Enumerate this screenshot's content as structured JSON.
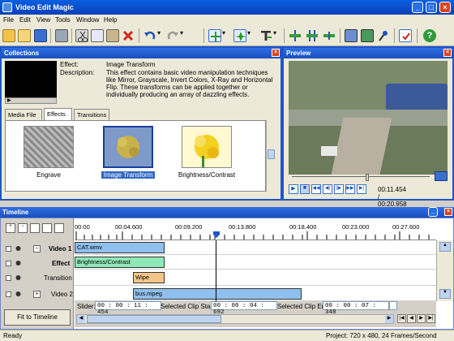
{
  "app": {
    "title": "Video Edit Magic"
  },
  "menu": [
    "File",
    "Edit",
    "View",
    "Tools",
    "Window",
    "Help"
  ],
  "collections": {
    "title": "Collections",
    "effect_label": "Effect:",
    "effect_value": "Image Transform",
    "description_label": "Description:",
    "description_value": "This effect contains basic video manipulation techniques like Mirror, Grayscale, Invert Colors, X-Ray and Horizontal Flip. These transforms can be applied together or individually producing an array of dazzling effects.",
    "tabs": [
      "Media File",
      "Effects",
      "Transitions"
    ],
    "active_tab": "Effects",
    "thumbnails": [
      {
        "label": "Engrave"
      },
      {
        "label": "Image Transform",
        "selected": true
      },
      {
        "label": "Brightness/Contrast"
      }
    ]
  },
  "preview": {
    "title": "Preview",
    "time": "00:11.454 / 00:20.958",
    "position": 0.55
  },
  "timeline": {
    "title": "Timeline",
    "ruler_labels": [
      "00:00",
      "00:04.600",
      "00:09.200",
      "00:13.800",
      "00:18.400",
      "00:23.000",
      "00:27.600"
    ],
    "tracks": [
      {
        "label": "Video 1",
        "bold": true,
        "expander": "−"
      },
      {
        "label": "Effect",
        "bold": true
      },
      {
        "label": "Transition"
      },
      {
        "label": "Video 2",
        "expander": "+"
      }
    ],
    "clips": {
      "video1": "CAT.wmv",
      "effect": "Brightness/Contrast",
      "transition": "Wipe",
      "video2": "bus.mpeg"
    },
    "fit_button": "Fit to Timeline",
    "slider_label": "Slider:",
    "slider_value": "00 : 00 : 11 : 454",
    "clip_start_label": "Selected Clip Start:",
    "clip_start_value": "00 : 00 : 04 : 692",
    "clip_end_label": "Selected Clip End:",
    "clip_end_value": "00 : 00 : 07 : 348"
  },
  "status": {
    "left": "Ready",
    "right": "Project: 720 x 480, 24 Frames/Second"
  },
  "colors": {
    "title_blue": "#0a5fe0",
    "panel_border": "#1e56c8",
    "clip_blue": "#8fc0ee",
    "clip_green": "#8fe8b8",
    "clip_orange": "#f5c68a",
    "playhead": "#1e56c8"
  }
}
